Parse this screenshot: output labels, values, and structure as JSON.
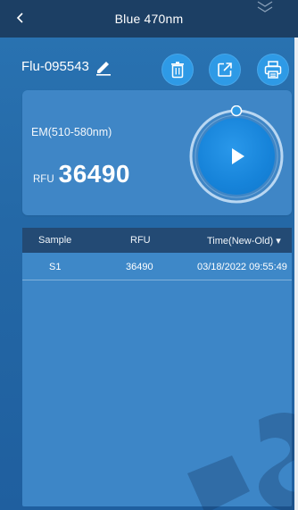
{
  "topbar": {
    "title": "Blue 470nm",
    "back_icon": "chevron-left-icon",
    "collapse_icon": "double-chevron-down-icon"
  },
  "header": {
    "file_name": "Flu-095543",
    "edit_icon": "pencil-icon",
    "actions": [
      {
        "name": "delete",
        "icon": "trash-icon"
      },
      {
        "name": "export",
        "icon": "export-icon"
      },
      {
        "name": "print",
        "icon": "printer-icon"
      }
    ]
  },
  "measurement": {
    "em_label": "EM(510-580nm)",
    "rfu_label": "RFU",
    "rfu_value": "36490",
    "play_icon": "play-icon"
  },
  "table": {
    "columns": [
      "Sample",
      "RFU",
      "Time(New-Old) ▾"
    ],
    "rows": [
      {
        "sample": "S1",
        "rfu": "36490",
        "time": "03/18/2022 09:55:49"
      }
    ]
  },
  "colors": {
    "background": "#2468a6",
    "topbar": "#1c3f64",
    "card": "#3f86c6",
    "table_header": "#234a74",
    "button": "#2e9ae6"
  }
}
